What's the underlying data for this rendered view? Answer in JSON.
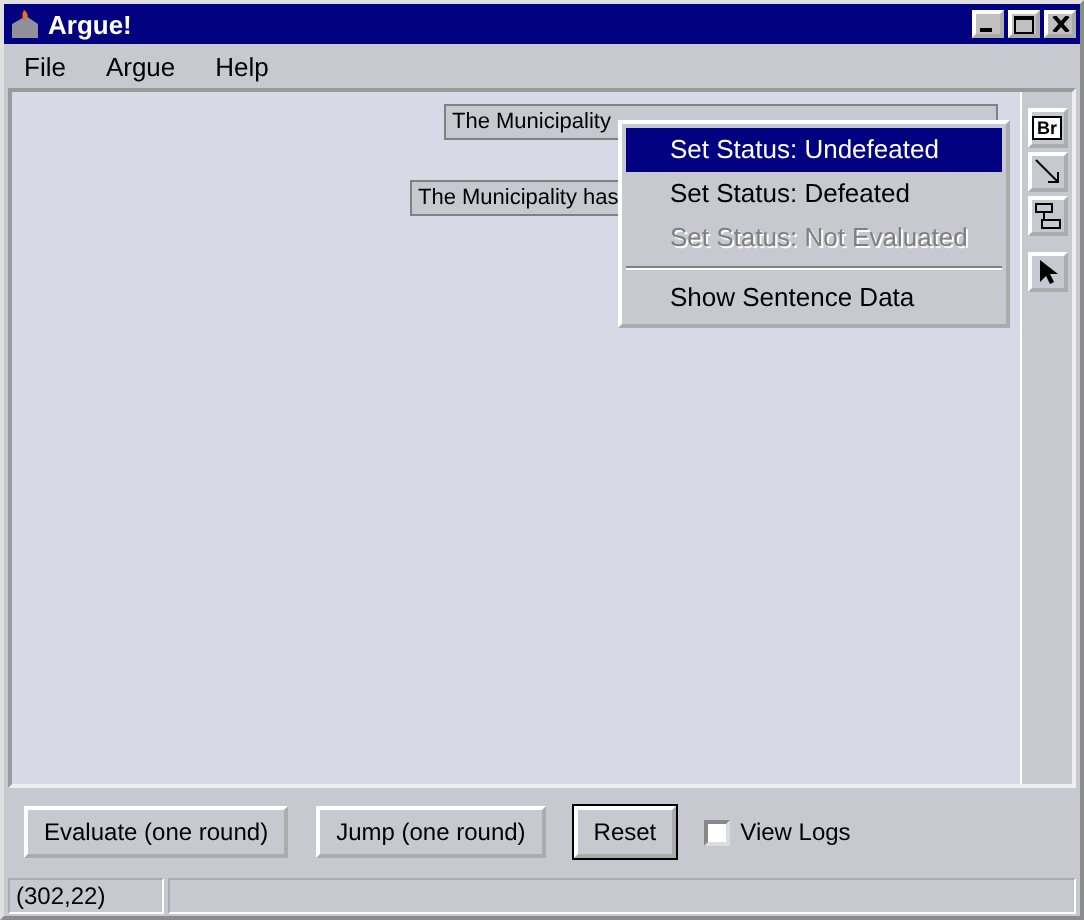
{
  "window": {
    "title": "Argue!"
  },
  "menu_bar": [
    "File",
    "Argue",
    "Help"
  ],
  "canvas": {
    "nodes": [
      {
        "text": "The Municipality"
      },
      {
        "text": "The Municipality has"
      }
    ]
  },
  "context_menu": [
    {
      "label": "Set Status: Undefeated",
      "selected": true,
      "disabled": false,
      "kind": "item"
    },
    {
      "label": "Set Status: Defeated",
      "selected": false,
      "disabled": false,
      "kind": "item"
    },
    {
      "label": "Set Status: Not Evaluated",
      "selected": false,
      "disabled": true,
      "kind": "item"
    },
    {
      "kind": "separator"
    },
    {
      "label": "Show Sentence Data",
      "selected": false,
      "disabled": false,
      "kind": "item"
    }
  ],
  "tool_palette": [
    {
      "kind": "text",
      "label": "Br"
    },
    {
      "kind": "arrow"
    },
    {
      "kind": "merge"
    },
    {
      "kind": "pointer"
    }
  ],
  "buttons": [
    {
      "label": "Evaluate (one round)",
      "focused": false
    },
    {
      "label": "Jump (one round)",
      "focused": false
    },
    {
      "label": "Reset",
      "focused": true
    }
  ],
  "view_logs": {
    "label": "View Logs",
    "checked": false
  },
  "status_bar": "(302,22)"
}
